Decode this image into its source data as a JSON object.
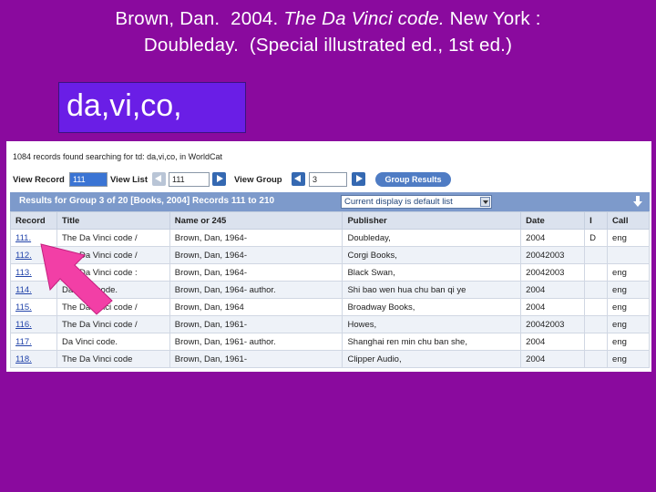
{
  "slide": {
    "title_line1": "Brown, Dan.  2004. The Da Vinci code. New York :",
    "title_line2": "Doubleday.  (Special illustrated ed., 1st ed.)",
    "title_italic": "The Da Vinci code."
  },
  "query_box": {
    "text": "da,vi,co,"
  },
  "worldcat": {
    "found_text": "1084 records found searching for td: da,vi,co, in WorldCat",
    "controls": {
      "view_record_label": "View Record",
      "view_record_value": "111",
      "view_list_label": "View List",
      "view_list_value": "111",
      "view_group_label": "View Group",
      "view_group_value": "3",
      "group_results_button": "Group Results"
    },
    "results_bar": {
      "text": "Results for Group 3 of 20 [Books, 2004] Records 111 to 210",
      "display_select": "Current display is default list"
    },
    "columns": [
      "Record",
      "Title",
      "Name or 245",
      "Publisher",
      "Date",
      "I",
      "Call"
    ],
    "rows": [
      [
        "111.",
        "The Da Vinci code /",
        "Brown, Dan, 1964-",
        "Doubleday,",
        "2004",
        "D",
        "eng"
      ],
      [
        "112.",
        "The Da Vinci code /",
        "Brown, Dan, 1964-",
        "Corgi Books,",
        "20042003",
        "",
        ""
      ],
      [
        "113.",
        "The Da Vinci code :",
        "Brown, Dan, 1964-",
        "Black Swan,",
        "20042003",
        "",
        "eng"
      ],
      [
        "114.",
        "Da Vinci code.",
        "Brown, Dan, 1964- author.",
        "Shi bao wen hua chu ban qi ye",
        "2004",
        "",
        "eng"
      ],
      [
        "115.",
        "The Da Vinci code /",
        "Brown, Dan, 1964",
        "Broadway Books,",
        "2004",
        "",
        "eng"
      ],
      [
        "116.",
        "The Da Vinci code /",
        "Brown, Dan, 1961-",
        "Howes,",
        "20042003",
        "",
        "eng"
      ],
      [
        "117.",
        "Da Vinci code.",
        "Brown, Dan, 1961- author.",
        "Shanghai ren min chu ban she,",
        "2004",
        "",
        "eng"
      ],
      [
        "118.",
        "The Da Vinci code",
        "Brown, Dan, 1961-",
        "Clipper Audio,",
        "2004",
        "",
        "eng"
      ]
    ]
  },
  "colors": {
    "background": "#8a0a9e",
    "query_box": "#6a1ee6",
    "arrow": "#f23fa6",
    "results_bar": "#7d9acb"
  }
}
